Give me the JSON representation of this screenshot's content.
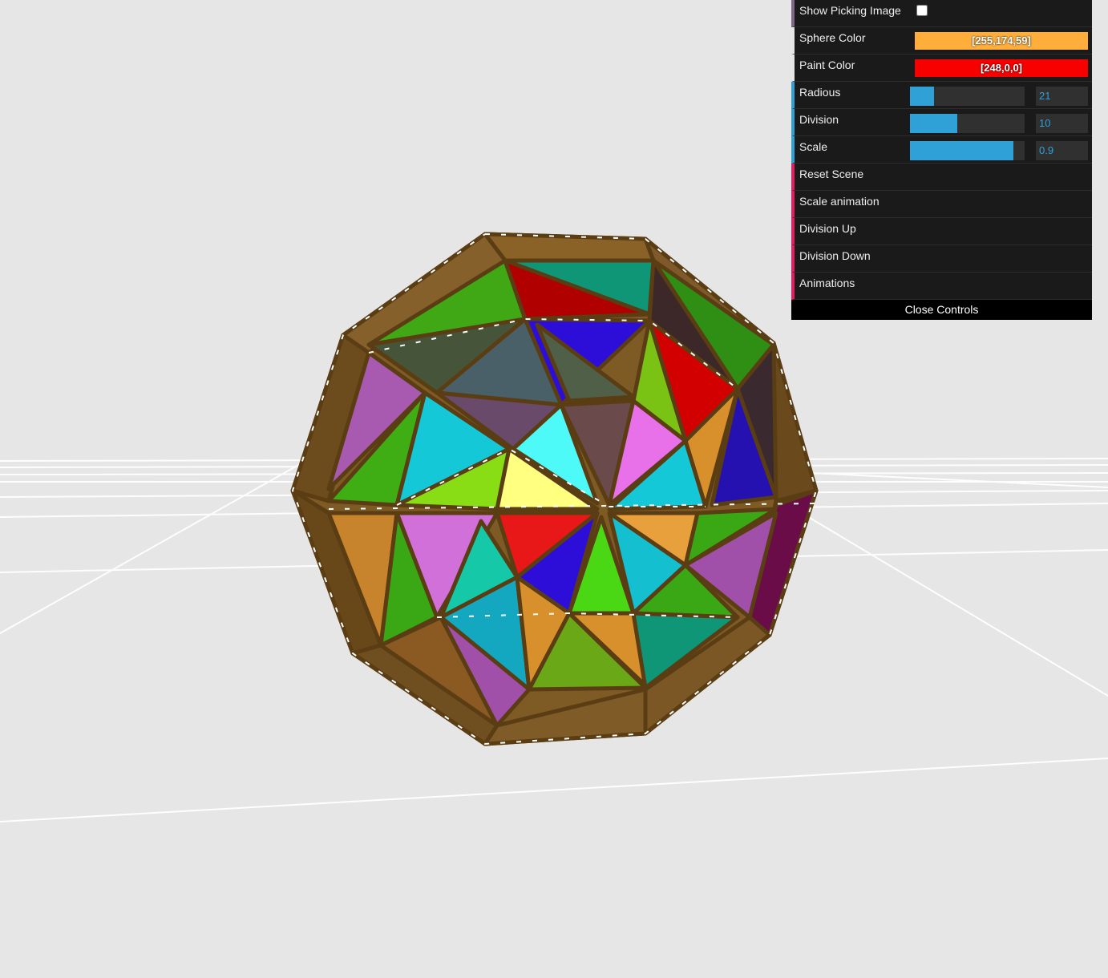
{
  "gui": {
    "show_picking_label": "Show Picking Image",
    "show_picking_checked": false,
    "sphere_color_label": "Sphere Color",
    "sphere_color_value": "[255,174,59]",
    "sphere_color_hex": "#ffae3b",
    "paint_color_label": "Paint Color",
    "paint_color_value": "[248,0,0]",
    "paint_color_hex": "#f80000",
    "radius": {
      "label": "Radious",
      "value": "21",
      "fraction": 0.21
    },
    "division": {
      "label": "Division",
      "value": "10",
      "fraction": 0.41
    },
    "scale": {
      "label": "Scale",
      "value": "0.9",
      "fraction": 0.9
    },
    "reset_label": "Reset Scene",
    "scale_anim_label": "Scale animation",
    "div_up_label": "Division Up",
    "div_down_label": "Division Down",
    "animations_label": "Animations",
    "close_label": "Close Controls"
  },
  "scene": {
    "background": "#e6e6e6",
    "grid_color": "#ffffff",
    "frame_color": "#7a5a26"
  }
}
